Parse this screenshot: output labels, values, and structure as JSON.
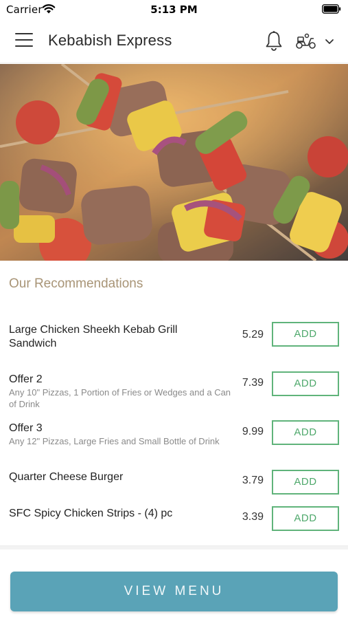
{
  "status_bar": {
    "carrier": "Carrier",
    "time": "5:13 PM"
  },
  "header": {
    "title": "Kebabish Express",
    "icons": [
      "menu-icon",
      "bell-icon",
      "scooter-icon",
      "chevron-down-icon"
    ]
  },
  "recommendations": {
    "title": "Our Recommendations",
    "add_label": "ADD",
    "items": [
      {
        "name": "Large Chicken Sheekh Kebab Grill Sandwich",
        "description": "",
        "price": "5.29"
      },
      {
        "name": "Offer 2",
        "description": "Any 10\" Pizzas, 1 Portion of Fries or Wedges and a Can of Drink",
        "price": "7.39"
      },
      {
        "name": "Offer 3",
        "description": "Any 12\" Pizzas, Large Fries and Small Bottle of Drink",
        "price": "9.99"
      },
      {
        "name": "Quarter Cheese Burger",
        "description": "",
        "price": "3.79"
      },
      {
        "name": "SFC Spicy Chicken Strips - (4) pc",
        "description": "",
        "price": "3.39"
      }
    ]
  },
  "view_menu_label": "VIEW MENU",
  "colors": {
    "accent_button": "#5aa3b7",
    "add_border": "#5fb37a",
    "section_title": "#a89476"
  }
}
